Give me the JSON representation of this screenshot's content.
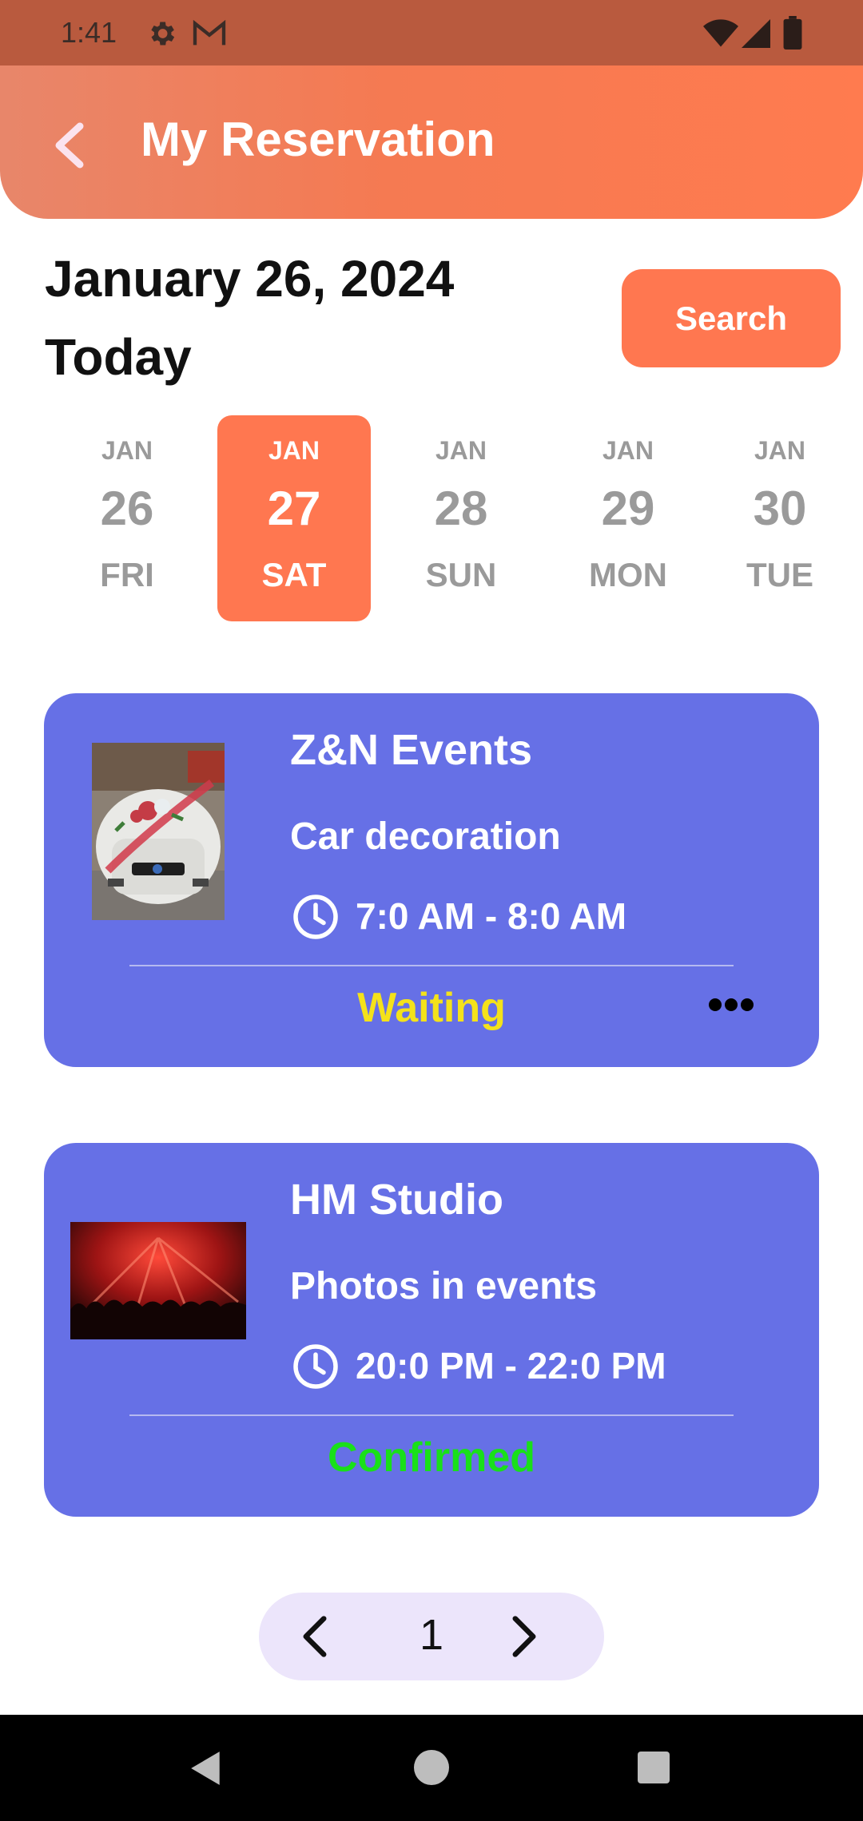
{
  "status_bar": {
    "time": "1:41"
  },
  "header": {
    "title": "My Reservation"
  },
  "date": {
    "full": "January 26, 2024",
    "relative": "Today"
  },
  "search": {
    "label": "Search"
  },
  "days": [
    {
      "month": "JAN",
      "day": "26",
      "weekday": "FRI",
      "selected": false
    },
    {
      "month": "JAN",
      "day": "27",
      "weekday": "SAT",
      "selected": true
    },
    {
      "month": "JAN",
      "day": "28",
      "weekday": "SUN",
      "selected": false
    },
    {
      "month": "JAN",
      "day": "29",
      "weekday": "MON",
      "selected": false
    },
    {
      "month": "JAN",
      "day": "30",
      "weekday": "TUE",
      "selected": false
    }
  ],
  "reservations": [
    {
      "provider": "Z&N Events",
      "service": "Car decoration",
      "time": "7:0 AM - 8:0 AM",
      "status": "Waiting",
      "status_color": "#f4e21a",
      "image": "decorated-car-photo"
    },
    {
      "provider": "HM Studio",
      "service": "Photos in events",
      "time": "20:0 PM - 22:0 PM",
      "status": "Confirmed",
      "status_color": "#19e019",
      "image": "concert-photo"
    }
  ],
  "pagination": {
    "page": "1"
  },
  "colors": {
    "accent": "#ff7750",
    "card": "#6670e6"
  }
}
